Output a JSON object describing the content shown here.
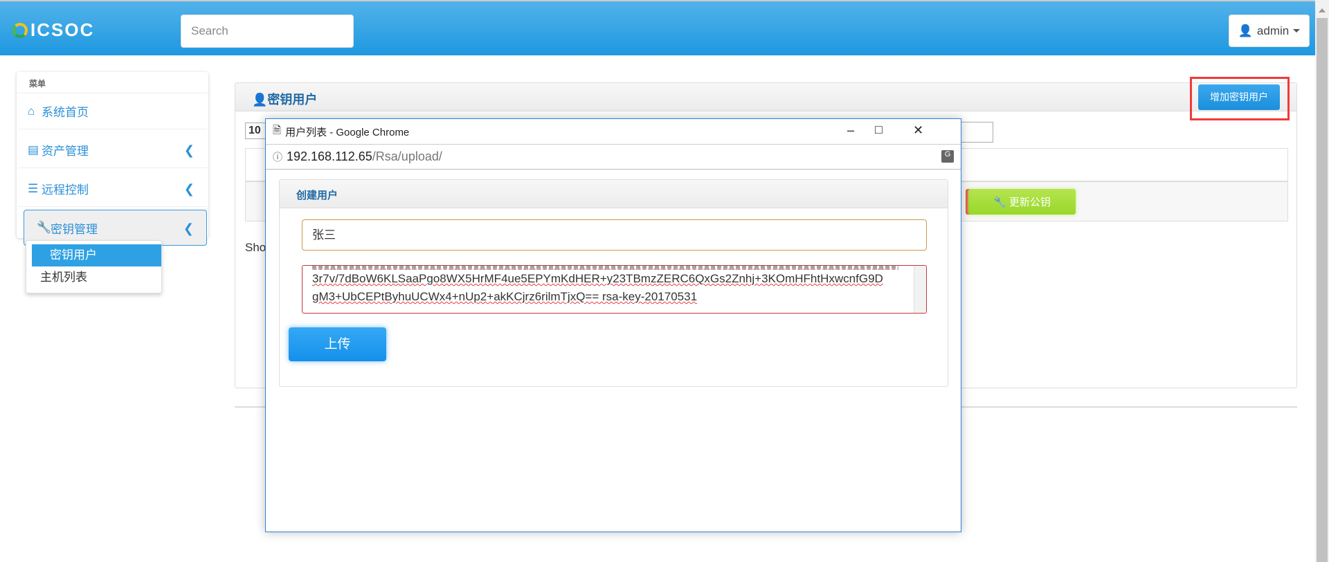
{
  "header": {
    "logo": "ICSOC",
    "search_placeholder": "Search",
    "user": "admin"
  },
  "sidebar": {
    "title": "菜单",
    "items": [
      {
        "label": "系统首页"
      },
      {
        "label": "资产管理"
      },
      {
        "label": "远程控制"
      },
      {
        "label": "密钥管理"
      }
    ],
    "submenu": [
      {
        "label": "密钥用户"
      },
      {
        "label": "主机列表"
      }
    ]
  },
  "main": {
    "title": "密钥用户",
    "add_button": "增加密钥用户",
    "page_length": "10",
    "update_key_button": "更新公钥",
    "showing": "Sho"
  },
  "popup": {
    "window_title": "用户列表 - Google Chrome",
    "url_host": "192.168.112.65",
    "url_path": "/Rsa/upload/",
    "panel_title": "创建用户",
    "name_value": "张三",
    "key_lines": [
      "3r7v/7dBoW6KLSaaPgo8WX5HrMF4ue5EPYmKdHER+y23TBmzZERC6QxGs2Znhj+3KOmHFhtHxwcnfG9D",
      "gM3+UbCEPtByhuUCWx4+nUp2+akKCjrz6rilmTjxQ== rsa-key-20170531"
    ],
    "upload_button": "上传"
  },
  "colors": {
    "brand": "#1e98e0",
    "success": "#98d82a",
    "highlight": "#f3383a"
  }
}
